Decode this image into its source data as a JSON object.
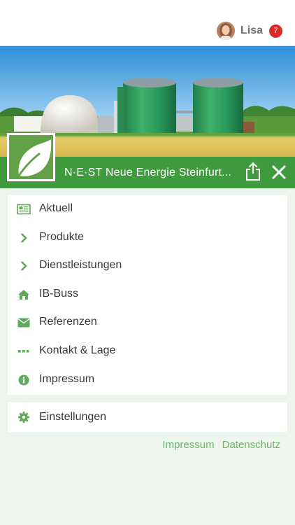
{
  "header": {
    "user_name": "Lisa",
    "notification_count": "7"
  },
  "brand": {
    "title": "N·E·ST Neue Energie Steinfurt..."
  },
  "menu": {
    "items": [
      {
        "label": "Aktuell",
        "icon": "newspaper-icon"
      },
      {
        "label": "Produkte",
        "icon": "chevron-right-icon"
      },
      {
        "label": "Dienstleistungen",
        "icon": "chevron-right-icon"
      },
      {
        "label": "IB-Buss",
        "icon": "home-icon"
      },
      {
        "label": "Referenzen",
        "icon": "envelope-icon"
      },
      {
        "label": "Kontakt & Lage",
        "icon": "ellipsis-icon"
      },
      {
        "label": "Impressum",
        "icon": "info-icon"
      }
    ]
  },
  "settings": {
    "label": "Einstellungen",
    "icon": "gear-icon"
  },
  "footer": {
    "links": [
      "Impressum",
      "Datenschutz"
    ]
  },
  "colors": {
    "brand_green": "#3f9b3d",
    "icon_green": "#5fa95a",
    "link_green": "#6fb46a",
    "badge_red": "#e02727",
    "background": "#eef5ee"
  }
}
